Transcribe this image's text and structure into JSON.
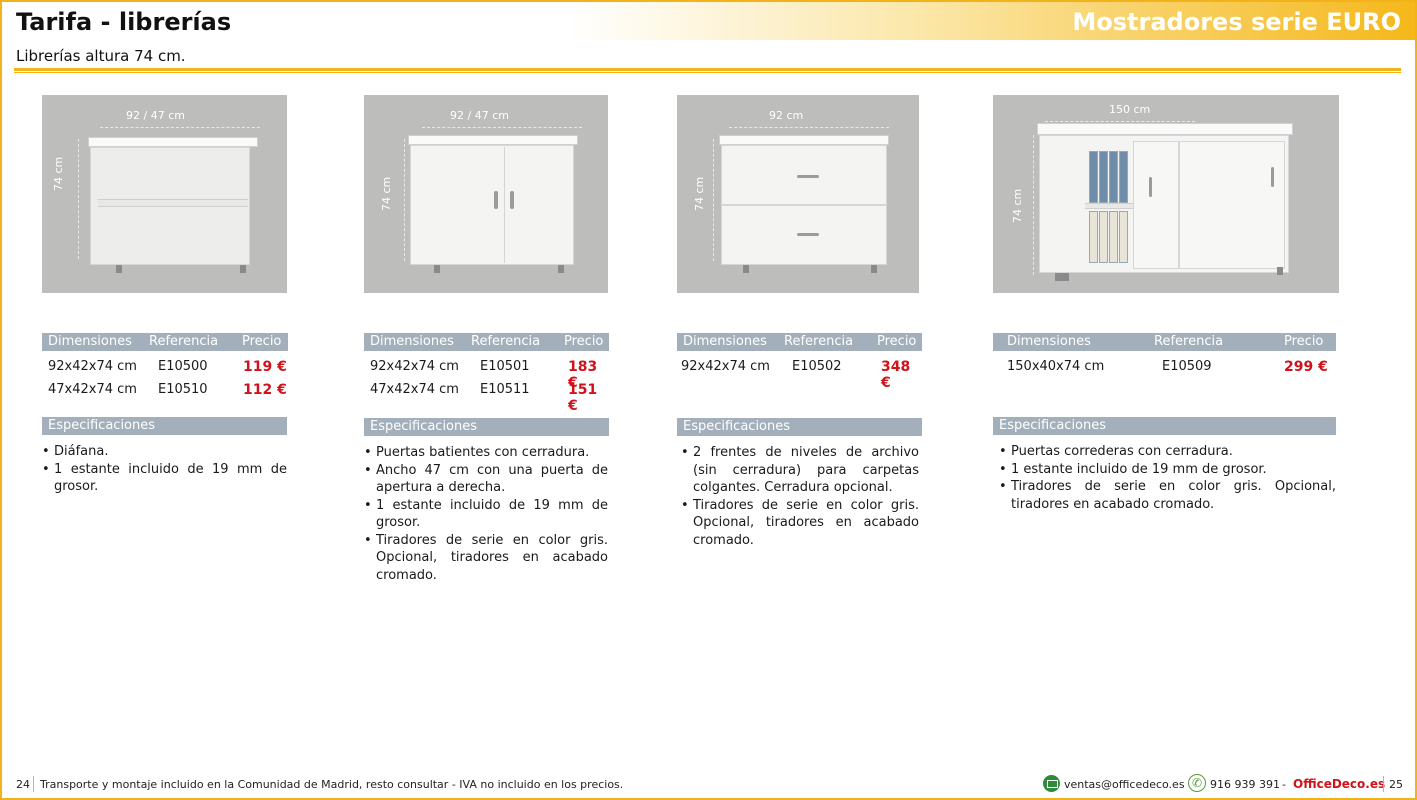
{
  "header": {
    "title_left": "Tarifa - librerías",
    "title_right": "Mostradores serie EURO",
    "subtitle": "Librerías altura 74 cm."
  },
  "colors": {
    "accent": "#f2b21a",
    "table_header": "#a3b0bc",
    "price": "#d0121b",
    "photo_bg": "#bdbdbc"
  },
  "table_headers": {
    "dimensiones": "Dimensiones",
    "referencia": "Referencia",
    "precio": "Precio"
  },
  "spec_title": "Especificaciones",
  "products": [
    {
      "width_label": "92 / 47 cm",
      "height_label": "74 cm",
      "rows": [
        {
          "dim": "92x42x74 cm",
          "ref": "E10500",
          "price": "119 €"
        },
        {
          "dim": "47x42x74 cm",
          "ref": "E10510",
          "price": "112 €"
        }
      ],
      "specs": [
        "Diáfana.",
        "1 estante incluido de 19 mm de grosor."
      ]
    },
    {
      "width_label": "92 / 47 cm",
      "height_label": "74 cm",
      "rows": [
        {
          "dim": "92x42x74 cm",
          "ref": "E10501",
          "price": "183 €"
        },
        {
          "dim": "47x42x74 cm",
          "ref": "E10511",
          "price": "151 €"
        }
      ],
      "specs": [
        "Puertas batientes con cerradura.",
        "Ancho 47 cm con una puerta de apertura a derecha.",
        "1 estante incluido de 19 mm de grosor.",
        "Tiradores de serie en color gris. Opcional, tiradores en acabado cromado."
      ]
    },
    {
      "width_label": "92 cm",
      "height_label": "74 cm",
      "rows": [
        {
          "dim": "92x42x74 cm",
          "ref": "E10502",
          "price": "348 €"
        }
      ],
      "specs": [
        "2 frentes de niveles de archivo (sin cerradura) para carpetas colgantes. Cerradura opcional.",
        "Tiradores de serie en color gris. Opcional, tiradores en acabado cromado."
      ]
    },
    {
      "width_label": "150 cm",
      "height_label": "74 cm",
      "rows": [
        {
          "dim": "150x40x74 cm",
          "ref": "E10509",
          "price": "299 €"
        }
      ],
      "specs": [
        "Puertas correderas con cerradura.",
        "1 estante incluido de 19 mm de grosor.",
        "Tiradores de serie en color gris. Opcional, tiradores en acabado cromado."
      ]
    }
  ],
  "footer": {
    "page_left": "24",
    "note": "Transporte y montaje incluido en la Comunidad de Madrid, resto consultar - IVA no incluido en los precios.",
    "email_icon": "mail-icon",
    "email": "ventas@officedeco.es",
    "phone_icon": "phone-icon",
    "phone": "916 939 391",
    "dash": "-",
    "brand": "OfficeDeco.es",
    "page_right": "25"
  }
}
